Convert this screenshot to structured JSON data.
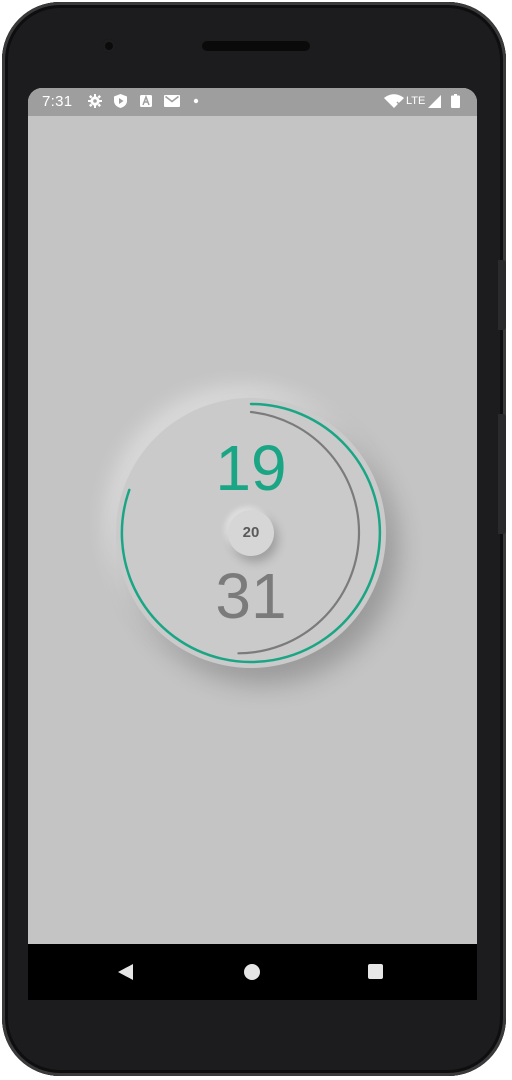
{
  "status_bar": {
    "time": "7:31",
    "network_label": "LTE",
    "icons": [
      "settings-icon",
      "play-protect-icon",
      "font-icon",
      "gmail-icon",
      "notification-dot-icon",
      "wifi-icon",
      "signal-icon",
      "battery-icon"
    ]
  },
  "dial": {
    "top_value": "19",
    "center_value": "20",
    "bottom_value": "31",
    "accent_color": "#1aa585",
    "secondary_color": "#7b7b7b"
  },
  "nav_bar": {
    "icons": [
      "back-icon",
      "home-icon",
      "recents-icon"
    ]
  }
}
